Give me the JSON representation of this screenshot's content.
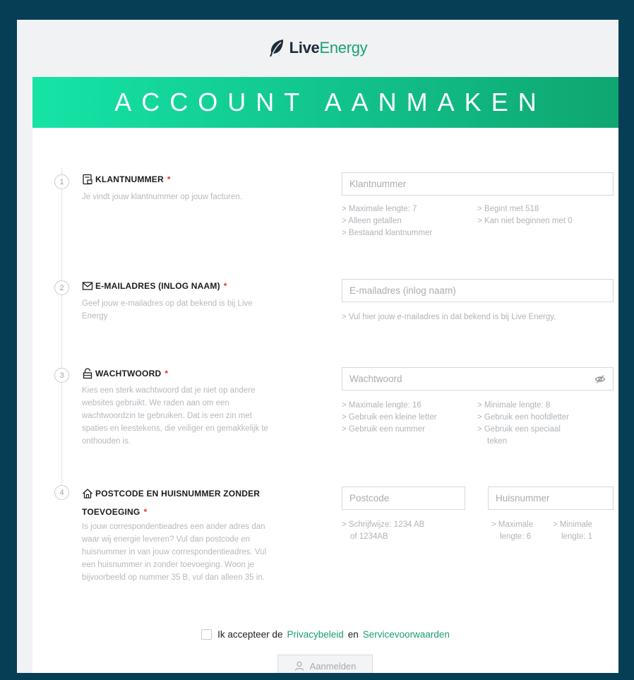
{
  "brand": {
    "live": "Live",
    "energy": "Energy"
  },
  "banner": {
    "title": "ACCOUNT AANMAKEN"
  },
  "steps": [
    {
      "number": "1",
      "title": "KLANTNUMMER",
      "required": "*",
      "description": "Je vindt jouw klantnummer op jouw facturen.",
      "placeholder": "Klantnummer",
      "hints_left": [
        "> Maximale lengte: 7",
        "> Alleen getallen",
        "> Bestaand klantnummer"
      ],
      "hints_right": [
        "> Begint met 518",
        "> Kan niet beginnen met 0"
      ]
    },
    {
      "number": "2",
      "title": "E-MAILADRES (INLOG NAAM)",
      "required": "*",
      "description_lines": [
        "Geef jouw e-mailadres op dat bekend is bij Live",
        "Energy"
      ],
      "placeholder": "E-mailadres (inlog naam)",
      "hint": "> Vul hier jouw e-mailadres in dat bekend is bij Live Energy."
    },
    {
      "number": "3",
      "title": "WACHTWOORD",
      "required": "*",
      "description_lines": [
        "Kies een sterk wachtwoord dat je niet op andere",
        "websites gebruikt. We raden aan om een",
        "wachtwoordzin te gebruiken. Dat is een zin met",
        "spaties en leestekens, die veiliger en gemakkelijk te",
        "onthouden is."
      ],
      "placeholder": "Wachtwoord",
      "hints_left": [
        "> Maximale lengte: 16",
        "> Gebruik een kleine letter",
        "> Gebruik een nummer"
      ],
      "hints_right": [
        "> Minimale lengte: 8",
        "> Gebruik een hoofdletter",
        "> Gebruik een speciaal",
        "teken"
      ]
    },
    {
      "number": "4",
      "title_line1": "POSTCODE EN HUISNUMMER ZONDER",
      "title_line2": "TOEVOEGING",
      "required": "*",
      "description_lines": [
        "Is jouw correspondentieadres een ander adres dan",
        "waar wij energie leveren? Vul dan postcode en",
        "huisnummer in van jouw correspondentieadres. Vul",
        "een huisnummer in zonder toevoeging. Woon je",
        "bijvoorbeeld op nummer 35 B, vul dan alleen 35 in."
      ],
      "postcode_placeholder": "Postcode",
      "huisnummer_placeholder": "Huisnummer",
      "postcode_hint": [
        "> Schrijfwijze: 1234 AB",
        "of 1234AB"
      ],
      "huisnummer_hint_max": [
        "> Maximale",
        "lengte: 6"
      ],
      "huisnummer_hint_min": [
        "> Minimale",
        "lengte: 1"
      ]
    }
  ],
  "agreement": {
    "prefix": "Ik accepteer de",
    "privacy": "Privacybeleid",
    "and": "en",
    "terms": "Servicevoorwaarden"
  },
  "submit": {
    "label": "Aanmelden"
  },
  "colors": {
    "accent": "#18a06f",
    "required": "#e5322d",
    "background": "#063e55"
  }
}
